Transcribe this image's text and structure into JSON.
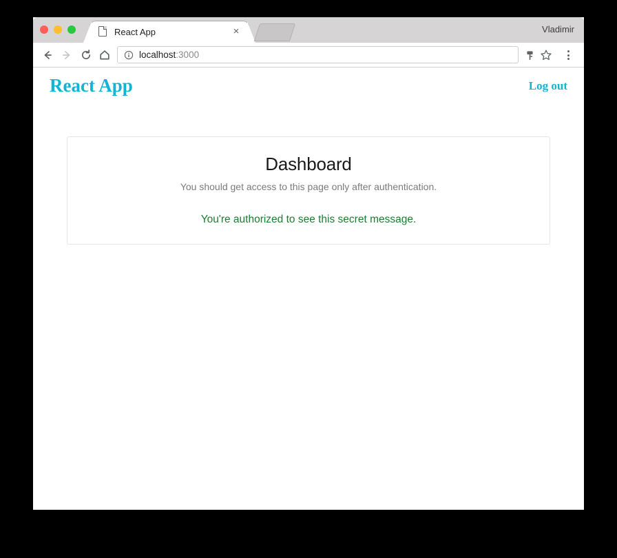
{
  "browser": {
    "window_controls": [
      {
        "name": "close",
        "color": "#ff5f57"
      },
      {
        "name": "minimize",
        "color": "#febc2e"
      },
      {
        "name": "maximize",
        "color": "#28c840"
      }
    ],
    "tab": {
      "title": "React App",
      "favicon": "page-icon",
      "close_label": "×"
    },
    "new_tab_slot_label": "",
    "profile_name": "Vladimir",
    "toolbar": {
      "back_icon": "back-arrow-icon",
      "forward_icon": "forward-arrow-icon",
      "reload_icon": "reload-icon",
      "home_icon": "home-icon",
      "info_icon": "info-circle-icon",
      "key_icon": "key-icon",
      "star_icon": "star-icon",
      "menu_icon": "three-dots-menu-icon",
      "url_host": "localhost",
      "url_port": ":3000"
    }
  },
  "page": {
    "brand": "React App",
    "logout_label": "Log out",
    "accent_color": "#12b4d4",
    "card": {
      "title": "Dashboard",
      "subtitle": "You should get access to this page only after authentication.",
      "message": "You're authorized to see this secret message.",
      "message_color": "#1a7d2e"
    }
  }
}
